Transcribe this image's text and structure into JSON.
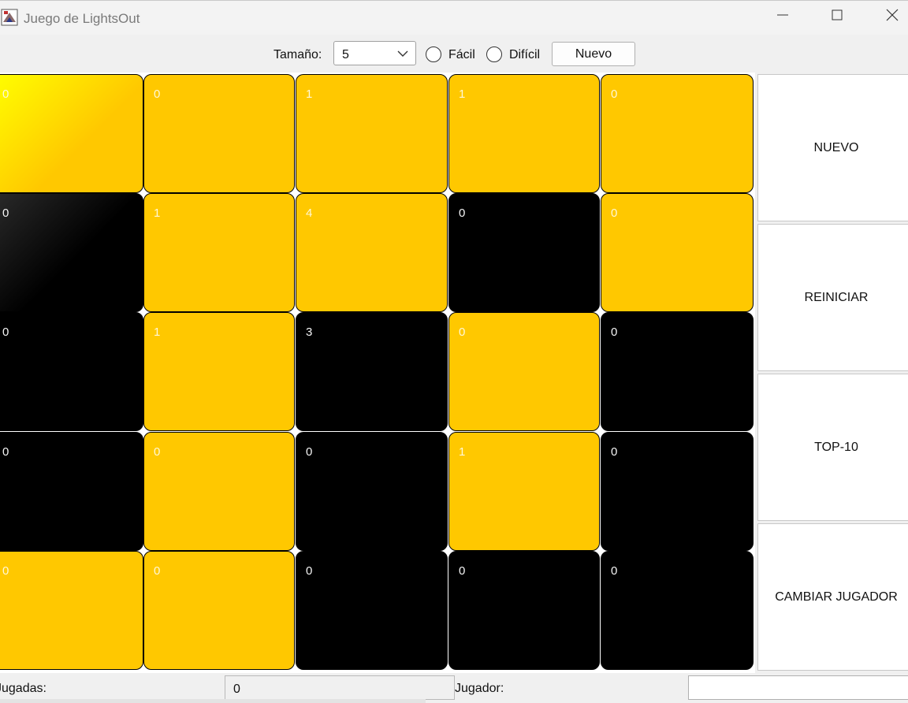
{
  "window": {
    "title": "Juego de LightsOut"
  },
  "toolbar": {
    "size_label": "Tamaño:",
    "size_value": "5",
    "easy_label": "Fácil",
    "easy_selected": false,
    "hard_label": "Difícil",
    "hard_selected": false,
    "new_label": "Nuevo"
  },
  "board": {
    "size": 5,
    "on_color": "#ffc800",
    "off_color": "#000000",
    "cells": [
      [
        {
          "state": "on",
          "count": "0"
        },
        {
          "state": "on",
          "count": "0"
        },
        {
          "state": "on",
          "count": "1"
        },
        {
          "state": "on",
          "count": "1"
        },
        {
          "state": "on",
          "count": "0"
        }
      ],
      [
        {
          "state": "off",
          "count": "0"
        },
        {
          "state": "on",
          "count": "1"
        },
        {
          "state": "on",
          "count": "4"
        },
        {
          "state": "off",
          "count": "0"
        },
        {
          "state": "on",
          "count": "0"
        }
      ],
      [
        {
          "state": "off",
          "count": "0"
        },
        {
          "state": "on",
          "count": "1"
        },
        {
          "state": "off",
          "count": "3"
        },
        {
          "state": "on",
          "count": "0"
        },
        {
          "state": "off",
          "count": "0"
        }
      ],
      [
        {
          "state": "off",
          "count": "0"
        },
        {
          "state": "on",
          "count": "0"
        },
        {
          "state": "off",
          "count": "0"
        },
        {
          "state": "on",
          "count": "1"
        },
        {
          "state": "off",
          "count": "0"
        }
      ],
      [
        {
          "state": "on",
          "count": "0"
        },
        {
          "state": "on",
          "count": "0"
        },
        {
          "state": "off",
          "count": "0"
        },
        {
          "state": "off",
          "count": "0"
        },
        {
          "state": "off",
          "count": "0"
        }
      ]
    ]
  },
  "side": {
    "new_label": "NUEVO",
    "restart_label": "REINICIAR",
    "top10_label": "TOP-10",
    "change_player_label": "CAMBIAR JUGADOR"
  },
  "status": {
    "moves_label": "Jugadas:",
    "moves_value": "0",
    "player_label": "Jugador:",
    "player_value": ""
  }
}
